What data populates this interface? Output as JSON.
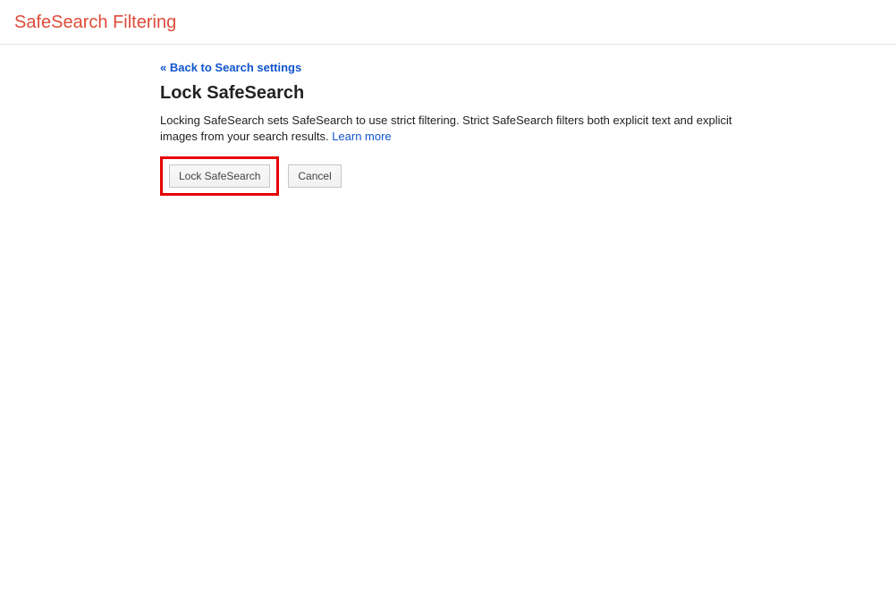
{
  "header": {
    "title": "SafeSearch Filtering"
  },
  "content": {
    "back_link": "« Back to Search settings",
    "heading": "Lock SafeSearch",
    "description": "Locking SafeSearch sets SafeSearch to use strict filtering. Strict SafeSearch filters both explicit text and explicit images from your search results. ",
    "learn_more": "Learn more",
    "buttons": {
      "lock": "Lock SafeSearch",
      "cancel": "Cancel"
    }
  }
}
